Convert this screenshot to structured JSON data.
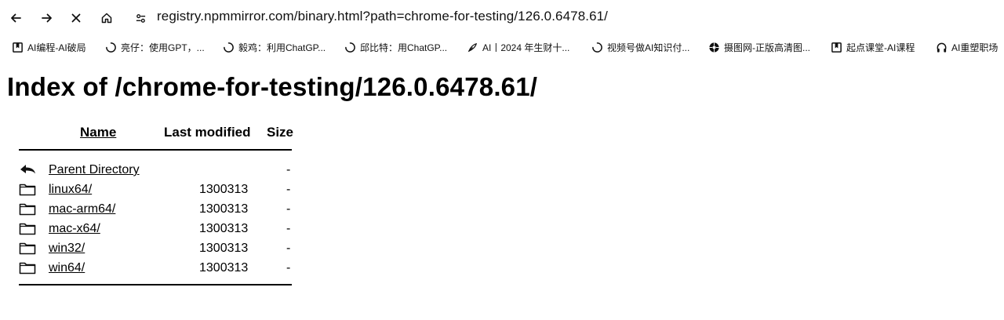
{
  "toolbar": {
    "url": "registry.npmmirror.com/binary.html?path=chrome-for-testing/126.0.6478.61/"
  },
  "bookmarks": [
    {
      "label": "AI编程-AI破局",
      "icon": "bookmark-square-icon"
    },
    {
      "label": "亮仔：使用GPT，...",
      "icon": "loading-icon"
    },
    {
      "label": "毅鸡：利用ChatGP...",
      "icon": "loading-icon"
    },
    {
      "label": "邱比特：用ChatGP...",
      "icon": "loading-icon"
    },
    {
      "label": "AI丨2024 年生财十...",
      "icon": "feather-icon"
    },
    {
      "label": "视频号做AI知识付...",
      "icon": "loading-icon"
    },
    {
      "label": "摄图网-正版高清图...",
      "icon": "aperture-icon"
    },
    {
      "label": "起点课堂-AI课程",
      "icon": "bookmark-square-icon"
    },
    {
      "label": "AI重塑职场",
      "icon": "headphones-icon"
    }
  ],
  "page": {
    "title": "Index of /chrome-for-testing/126.0.6478.61/",
    "columns": {
      "name": "Name",
      "modified": "Last modified",
      "size": "Size"
    },
    "rows": [
      {
        "name": "Parent Directory",
        "modified": "",
        "size": "-",
        "icon": "back-arrow-icon"
      },
      {
        "name": "linux64/",
        "modified": "1300313",
        "size": "-",
        "icon": "folder-icon"
      },
      {
        "name": "mac-arm64/",
        "modified": "1300313",
        "size": "-",
        "icon": "folder-icon"
      },
      {
        "name": "mac-x64/",
        "modified": "1300313",
        "size": "-",
        "icon": "folder-icon"
      },
      {
        "name": "win32/",
        "modified": "1300313",
        "size": "-",
        "icon": "folder-icon"
      },
      {
        "name": "win64/",
        "modified": "1300313",
        "size": "-",
        "icon": "folder-icon"
      }
    ]
  }
}
